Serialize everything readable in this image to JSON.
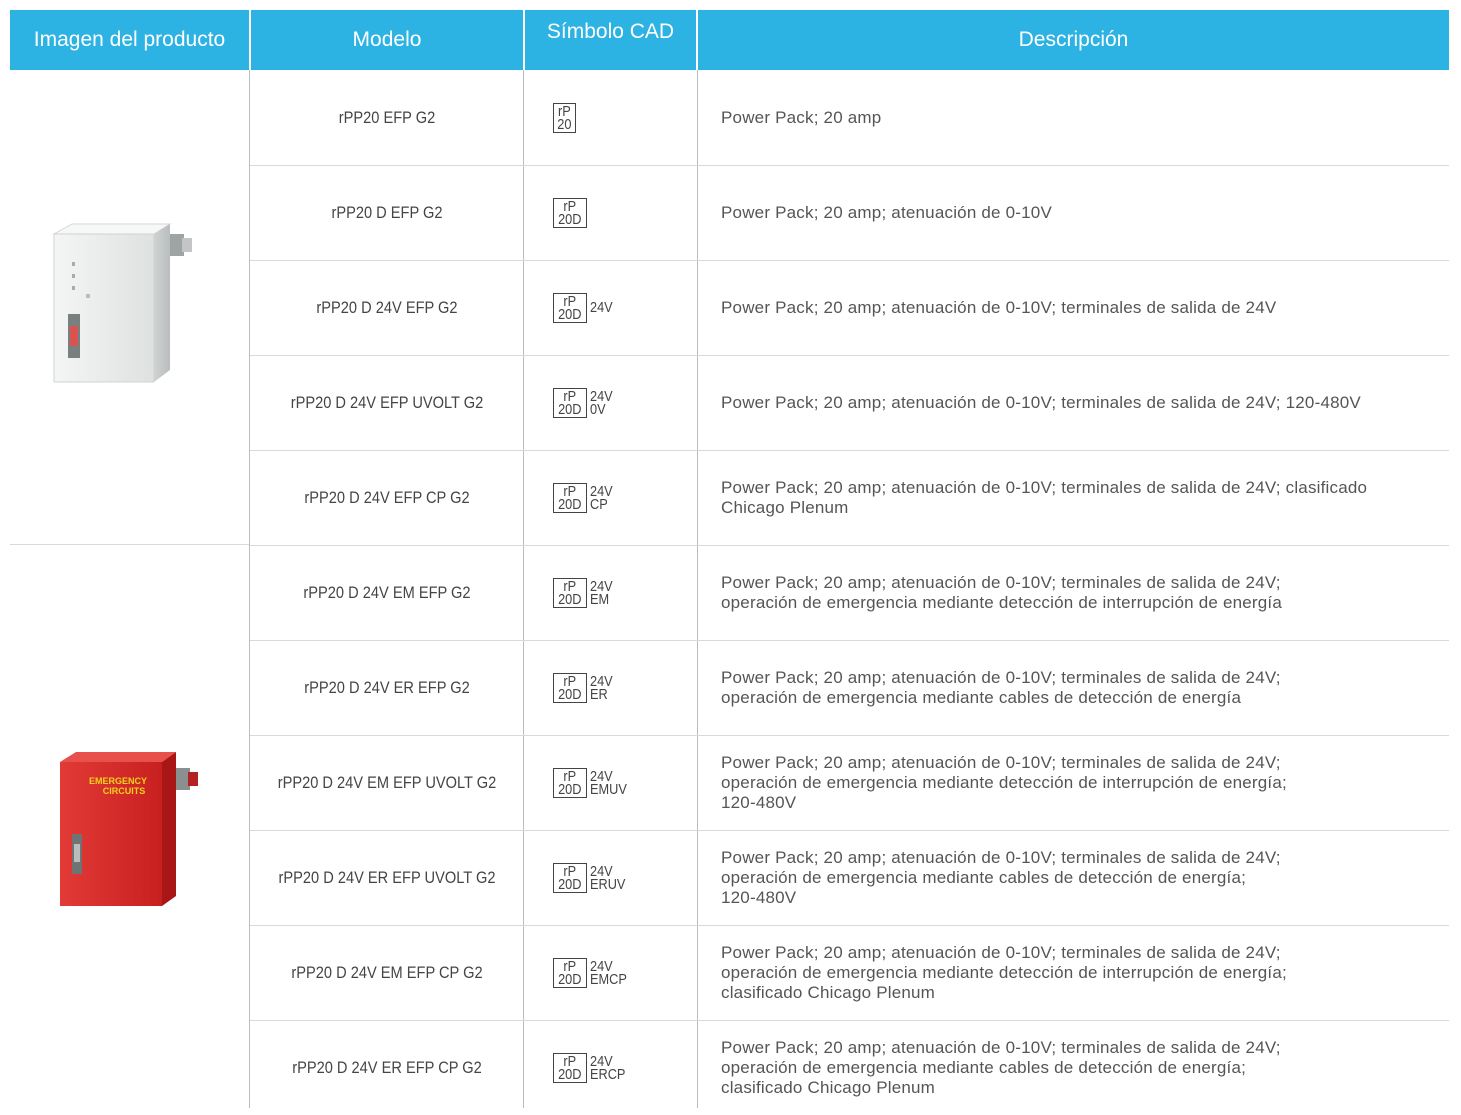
{
  "headers": {
    "image": "Imagen del producto",
    "model": "Modelo",
    "cad": "Símbolo CAD",
    "description": "Descripción"
  },
  "colors": {
    "header_bg": "#2cb3e3",
    "header_text": "#ffffff"
  },
  "products": [
    {
      "name": "white-power-pack",
      "label_lines": []
    },
    {
      "name": "red-emergency-power-pack",
      "label_lines": [
        "EMERGENCY",
        "CIRCUITS"
      ]
    }
  ],
  "rows": [
    {
      "model": "rPP20 EFP G2",
      "cad_top": "rP",
      "cad_bottom": "20",
      "cad_suffix_top": "",
      "cad_suffix_bottom": "",
      "desc_lines": [
        "Power Pack; 20 amp"
      ]
    },
    {
      "model": "rPP20 D EFP G2",
      "cad_top": "rP",
      "cad_bottom": "20D",
      "cad_suffix_top": "",
      "cad_suffix_bottom": "",
      "desc_lines": [
        "Power Pack; 20 amp; atenuación de 0-10V"
      ]
    },
    {
      "model": "rPP20 D 24V EFP G2",
      "cad_top": "rP",
      "cad_bottom": "20D",
      "cad_suffix_top": "",
      "cad_suffix_bottom": "24V",
      "desc_lines": [
        "Power Pack; 20 amp; atenuación de 0-10V; terminales de salida de 24V"
      ]
    },
    {
      "model": "rPP20 D 24V EFP UVOLT G2",
      "cad_top": "rP",
      "cad_bottom": "20D",
      "cad_suffix_top": "24V",
      "cad_suffix_bottom": "0V",
      "desc_lines": [
        "Power Pack; 20 amp; atenuación de 0-10V; terminales de salida de 24V; 120-480V"
      ]
    },
    {
      "model": "rPP20 D 24V EFP CP G2",
      "cad_top": "rP",
      "cad_bottom": "20D",
      "cad_suffix_top": "24V",
      "cad_suffix_bottom": "CP",
      "desc_lines": [
        "Power Pack; 20 amp; atenuación de 0-10V; terminales de salida de 24V; clasificado",
        "Chicago Plenum"
      ]
    },
    {
      "model": "rPP20 D 24V EM EFP G2",
      "cad_top": "rP",
      "cad_bottom": "20D",
      "cad_suffix_top": "24V",
      "cad_suffix_bottom": "EM",
      "desc_lines": [
        "Power Pack; 20 amp; atenuación de 0-10V; terminales de salida de 24V;",
        "operación de emergencia mediante detección de interrupción de energía"
      ]
    },
    {
      "model": "rPP20 D 24V ER EFP G2",
      "cad_top": "rP",
      "cad_bottom": "20D",
      "cad_suffix_top": "24V",
      "cad_suffix_bottom": "ER",
      "desc_lines": [
        "Power Pack; 20 amp; atenuación de 0-10V; terminales de salida de 24V;",
        "operación de emergencia mediante cables de detección de energía"
      ]
    },
    {
      "model": "rPP20 D 24V EM EFP UVOLT G2",
      "cad_top": "rP",
      "cad_bottom": "20D",
      "cad_suffix_top": "24V",
      "cad_suffix_bottom": "EMUV",
      "desc_lines": [
        "Power Pack; 20 amp; atenuación de 0-10V; terminales de salida de 24V;",
        "operación de emergencia mediante detección de interrupción de energía;",
        "120-480V"
      ]
    },
    {
      "model": "rPP20 D 24V ER EFP UVOLT G2",
      "cad_top": "rP",
      "cad_bottom": "20D",
      "cad_suffix_top": "24V",
      "cad_suffix_bottom": "ERUV",
      "desc_lines": [
        "Power Pack; 20 amp; atenuación de 0-10V; terminales de salida de 24V;",
        "operación de emergencia mediante cables de detección de energía;",
        "120-480V"
      ]
    },
    {
      "model": "rPP20 D 24V EM EFP CP G2",
      "cad_top": "rP",
      "cad_bottom": "20D",
      "cad_suffix_top": "24V",
      "cad_suffix_bottom": "EMCP",
      "desc_lines": [
        "Power Pack; 20 amp; atenuación de 0-10V; terminales de salida de 24V;",
        "operación de emergencia mediante detección de interrupción de energía;",
        "clasificado Chicago Plenum"
      ]
    },
    {
      "model": "rPP20 D 24V ER EFP CP G2",
      "cad_top": "rP",
      "cad_bottom": "20D",
      "cad_suffix_top": "24V",
      "cad_suffix_bottom": "ERCP",
      "desc_lines": [
        "Power Pack; 20 amp; atenuación de 0-10V; terminales de salida de 24V;",
        "operación de emergencia mediante cables de detección de energía;",
        "clasificado Chicago Plenum"
      ]
    }
  ]
}
